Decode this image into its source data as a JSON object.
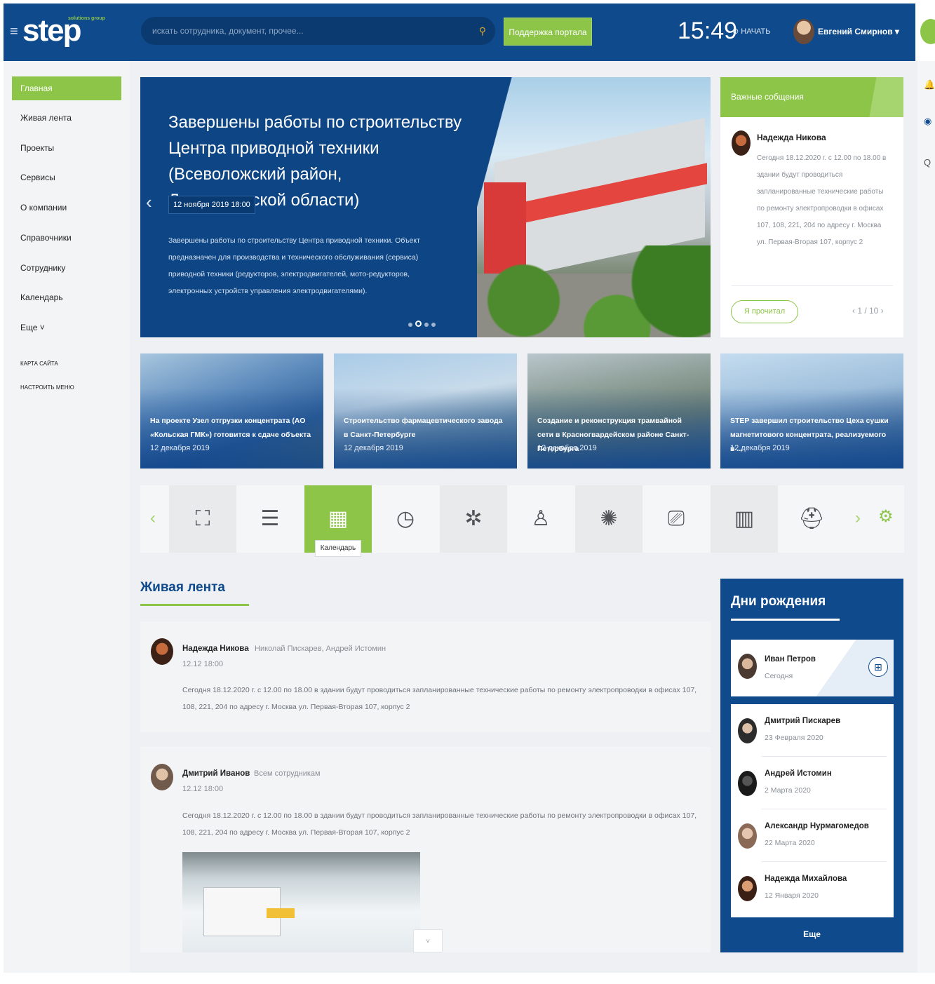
{
  "header": {
    "logo": "step",
    "logo_mark": "solutions group",
    "search_placeholder": "искать сотрудника, документ, прочее...",
    "search_icon": "search-icon",
    "support_label": "Поддержка портала",
    "clock": "15:49",
    "start_label": "⊙ НАЧАТЬ",
    "user_name": "Евгений Смирнов ▾"
  },
  "sidebar": {
    "items": [
      {
        "label": "Главная",
        "active": true
      },
      {
        "label": "Живая лента"
      },
      {
        "label": "Проекты"
      },
      {
        "label": "Сервисы"
      },
      {
        "label": "О компании"
      },
      {
        "label": "Справочники"
      },
      {
        "label": "Сотруднику"
      },
      {
        "label": "Календарь"
      },
      {
        "label": "Еще ˅"
      }
    ],
    "links": [
      "КАРТА САЙТА",
      "НАСТРОИТЬ МЕНЮ"
    ]
  },
  "hero": {
    "title": "Завершены работы по строительству Центра приводной техники (Всеволожский район, Ленинградской области)",
    "date": "12 ноября 2019 18:00",
    "text": "Завершены работы по строительству Центра приводной техники. Объект предназначен для производства и технического обслуживания (сервиса) приводной техники (редукторов, электродвигателей, мото-редукторов, электронных устройств управления электродвигателями)."
  },
  "important": {
    "title": "Важные собщения",
    "author": "Надежда Никова",
    "text": "Сегодня 18.12.2020 г. с 12.00 по 18.00 в здании будут проводиться запланированные технические работы по ремонту электропроводки в офисах 107, 108, 221, 204 по адресу г. Москва ул. Первая-Вторая 107, корпус 2",
    "read_label": "Я прочитал",
    "pager": "‹  1 / 10  ›"
  },
  "news": [
    {
      "title": "На проекте Узел отгрузки концентрата (АО «Кольская ГМК») готовится к сдаче объекта",
      "date": "12 декабря 2019"
    },
    {
      "title": "Строительство фармацевтического завода в Санкт-Петербурге",
      "date": "12 декабря 2019"
    },
    {
      "title": "Создание и реконструкция трамвайной сети в Красногвардейском районе Санкт-Петербурга",
      "date": "12 декабря 2019"
    },
    {
      "title": "STEP завершил строительство Цеха сушки магнетитового концентрата, реализуемого в ...",
      "date": "12 декабря 2019"
    }
  ],
  "services": {
    "tiles": [
      "org-chart-icon",
      "database-icon",
      "calendar-icon",
      "clock-icon",
      "network-icon",
      "users-icon",
      "settings-brain-icon",
      "laptop-icon",
      "building-icon",
      "helmet-icon"
    ],
    "tooltip": "Календарь"
  },
  "feed": {
    "title": "Живая лента",
    "posts": [
      {
        "author": "Надежда Никова",
        "to": "Николай Пискарев, Андрей Истомин",
        "time": "12.12 18:00",
        "text": "Сегодня 18.12.2020 г. с 12.00 по 18.00 в здании будут проводиться запланированные технические работы по ремонту электропроводки в офисах 107, 108, 221, 204 по адресу г. Москва ул. Первая-Вторая 107, корпус 2"
      },
      {
        "author": "Дмитрий Иванов",
        "to": "Всем сотрудникам",
        "time": "12.12 18:00",
        "text": "Сегодня 18.12.2020 г. с 12.00 по 18.00 в здании будут проводиться запланированные технические работы по ремонту электропроводки в офисах 107, 108, 221, 204 по адресу г. Москва ул. Первая-Вторая 107, корпус 2"
      }
    ]
  },
  "birthdays": {
    "title": "Дни рождения",
    "featured": {
      "name": "Иван Петров",
      "date": "Сегодня"
    },
    "list": [
      {
        "name": "Дмитрий Пискарев",
        "date": "23 Февраля 2020"
      },
      {
        "name": "Андрей Истомин",
        "date": "2 Марта 2020"
      },
      {
        "name": "Александр Нурмагомедов",
        "date": "22 Марта 2020"
      },
      {
        "name": "Надежда Михайлова",
        "date": "12 Января 2020"
      }
    ],
    "more_label": "Еще"
  }
}
